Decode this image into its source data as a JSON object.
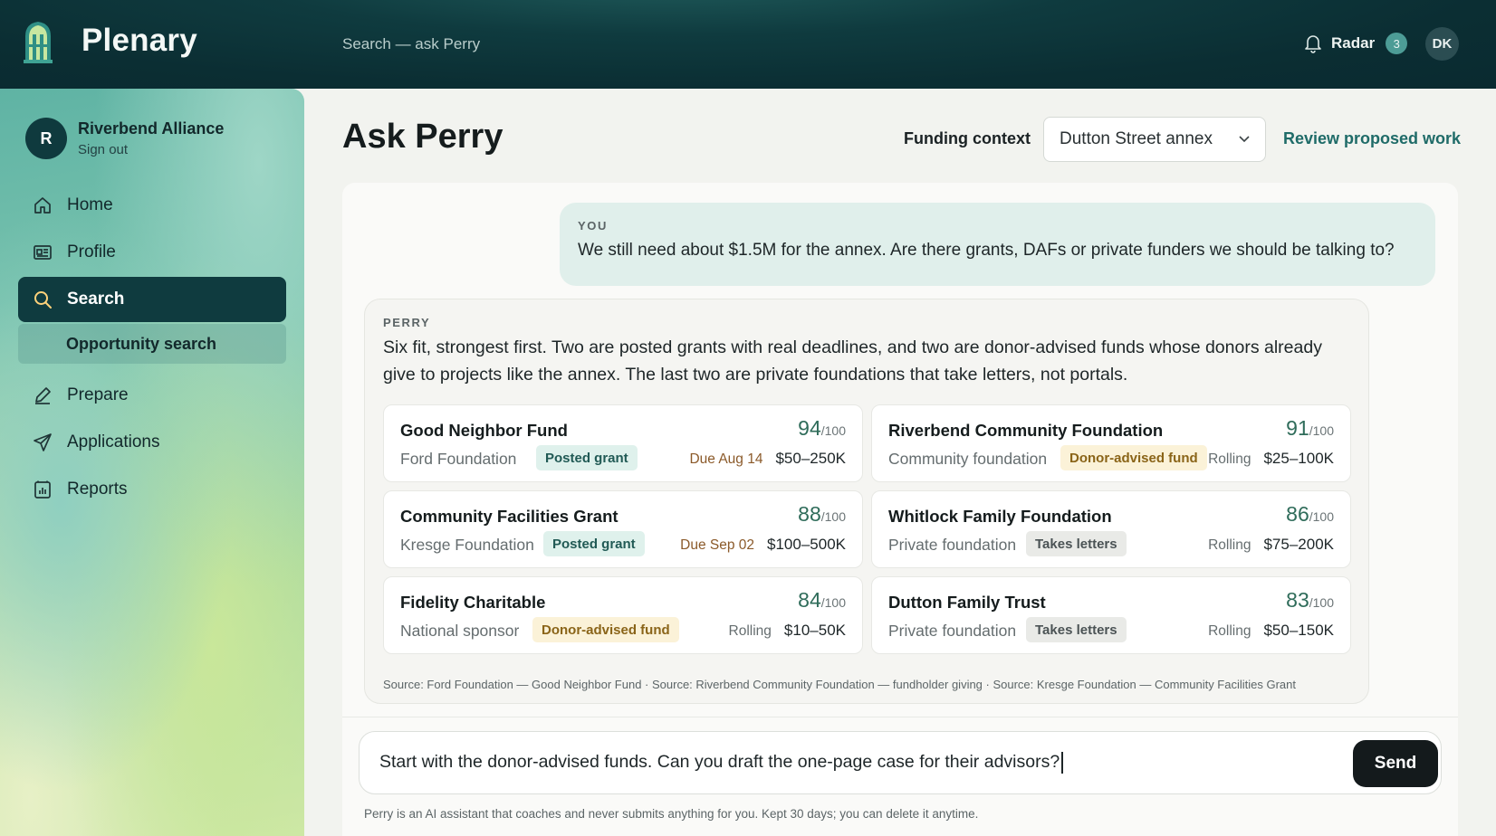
{
  "app": {
    "brand": "Plenary",
    "search_hint": "Search — ask Perry",
    "radar_label": "Radar",
    "radar_count": "3",
    "user_initials": "DK"
  },
  "sidebar": {
    "org_initial": "R",
    "org_name": "Riverbend Alliance",
    "sign_out": "Sign out",
    "items": [
      {
        "label": "Home",
        "icon": "home-icon"
      },
      {
        "label": "Profile",
        "icon": "id-card-icon"
      },
      {
        "label": "Search",
        "icon": "search-icon",
        "active": true
      },
      {
        "label": "Prepare",
        "icon": "pen-icon"
      },
      {
        "label": "Applications",
        "icon": "send-icon"
      },
      {
        "label": "Reports",
        "icon": "report-icon"
      }
    ],
    "subitem": "Opportunity search"
  },
  "header": {
    "title": "Ask Perry",
    "funding_context_label": "Funding context",
    "funding_context_value": "Dutton Street annex",
    "review_link": "Review proposed work"
  },
  "chat": {
    "you_label": "YOU",
    "you_message": "We still need about $1.5M for the annex. Are there grants, DAFs or private funders we should be talking to?",
    "perry_label": "PERRY",
    "perry_message": "Six fit, strongest first. Two are posted grants with real deadlines, and two are donor-advised funds whose donors already give to projects like the annex. The last two are private foundations that take letters, not portals.",
    "score_suffix": "/100",
    "opportunities": [
      {
        "name": "Good Neighbor Fund",
        "score": "94",
        "funder": "Ford Foundation",
        "tag": "Posted grant",
        "tag_type": "posted",
        "timing": "Due Aug 14",
        "timing_type": "due",
        "range": "$50–250K"
      },
      {
        "name": "Riverbend Community Foundation",
        "score": "91",
        "funder": "Community foundation",
        "tag": "Donor-advised fund",
        "tag_type": "daf",
        "timing": "Rolling",
        "timing_type": "rolling",
        "range": "$25–100K"
      },
      {
        "name": "Community Facilities Grant",
        "score": "88",
        "funder": "Kresge Foundation",
        "tag": "Posted grant",
        "tag_type": "posted",
        "timing": "Due Sep 02",
        "timing_type": "due",
        "range": "$100–500K"
      },
      {
        "name": "Whitlock Family Foundation",
        "score": "86",
        "funder": "Private foundation",
        "tag": "Takes letters",
        "tag_type": "letters",
        "timing": "Rolling",
        "timing_type": "rolling",
        "range": "$75–200K"
      },
      {
        "name": "Fidelity Charitable",
        "score": "84",
        "funder": "National sponsor",
        "tag": "Donor-advised fund",
        "tag_type": "daf",
        "timing": "Rolling",
        "timing_type": "rolling",
        "range": "$10–50K"
      },
      {
        "name": "Dutton Family Trust",
        "score": "83",
        "funder": "Private foundation",
        "tag": "Takes letters",
        "tag_type": "letters",
        "timing": "Rolling",
        "timing_type": "rolling",
        "range": "$50–150K"
      }
    ],
    "sources": "Source: Ford Foundation — Good Neighbor Fund · Source: Riverbend Community Foundation — fundholder giving · Source: Kresge Foundation — Community Facilities Grant"
  },
  "composer": {
    "draft": "Start with the donor-advised funds. Can you draft the one-page case for their advisors?",
    "send_label": "Send",
    "disclaimer": "Perry is an AI assistant that coaches and never submits anything for you. Kept 30 days; you can delete it anytime."
  },
  "colors": {
    "topbar": "#0f3b3f",
    "active_nav": "#0f3b3f",
    "accent_link": "#1f6b68",
    "score": "#2f6c5a",
    "posted_tag": "#dff1ec",
    "daf_tag": "#fbf2d8",
    "letters_tag": "#e9eae7",
    "send_button": "#141a1c"
  }
}
